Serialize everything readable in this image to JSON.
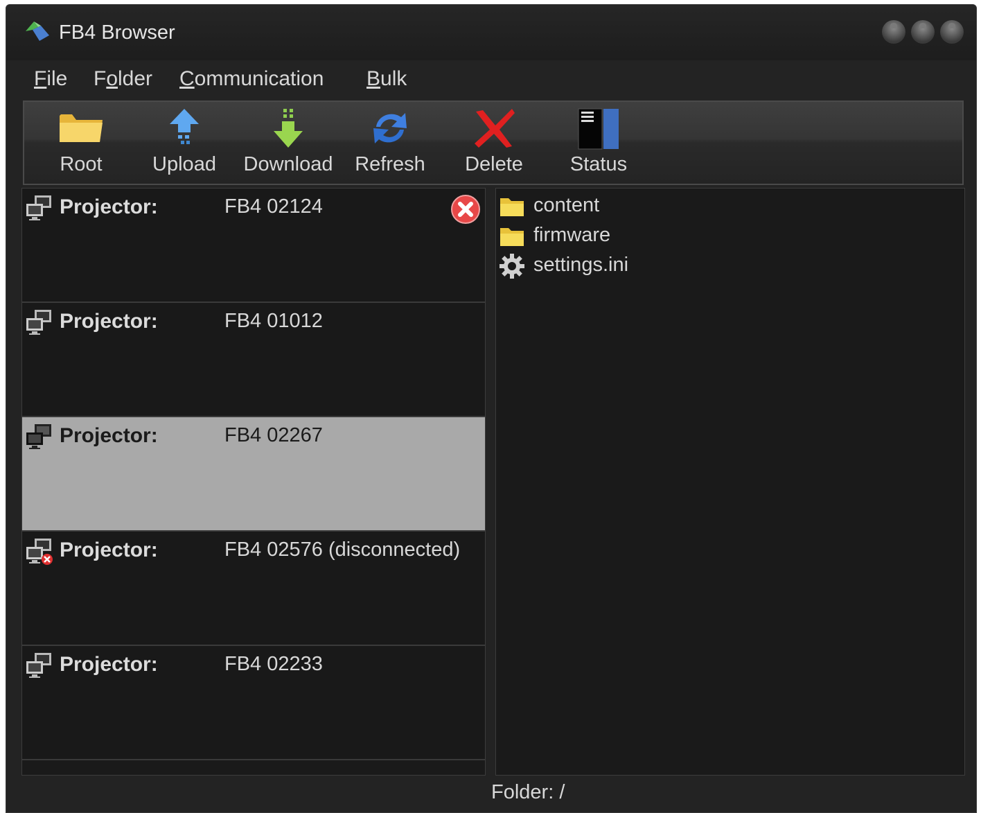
{
  "window": {
    "title": "FB4 Browser"
  },
  "menu": {
    "items": [
      {
        "label": "File",
        "access": "F",
        "rest": "ile",
        "pre": ""
      },
      {
        "label": "Folder",
        "pre": "F",
        "access": "o",
        "rest": "lder"
      },
      {
        "label": "Communication",
        "pre": "",
        "access": "C",
        "rest": "ommunication"
      },
      {
        "label": "Bulk",
        "pre": "",
        "access": "B",
        "rest": "ulk"
      }
    ]
  },
  "toolbar": {
    "root": "Root",
    "upload": "Upload",
    "download": "Download",
    "refresh": "Refresh",
    "delete": "Delete",
    "status": "Status"
  },
  "projectors": [
    {
      "label": "Projector:",
      "name": "FB4 02124",
      "state": "connected",
      "removable": true
    },
    {
      "label": "Projector:",
      "name": "FB4 01012",
      "state": "connected"
    },
    {
      "label": "Projector:",
      "name": "FB4 02267",
      "state": "selected"
    },
    {
      "label": "Projector:",
      "name": "FB4 02576 (disconnected)",
      "state": "disconnected"
    },
    {
      "label": "Projector:",
      "name": "FB4 02233",
      "state": "connected"
    }
  ],
  "files": [
    {
      "name": "content",
      "icon": "folder-icon"
    },
    {
      "name": "firmware",
      "icon": "folder-icon"
    },
    {
      "name": "settings.ini",
      "icon": "gear-icon"
    }
  ],
  "status": {
    "folder": "Folder: /"
  },
  "colors": {
    "background": "#1a1a1a",
    "selected_row": "#a9a9a9",
    "text": "#d8d8d8"
  }
}
